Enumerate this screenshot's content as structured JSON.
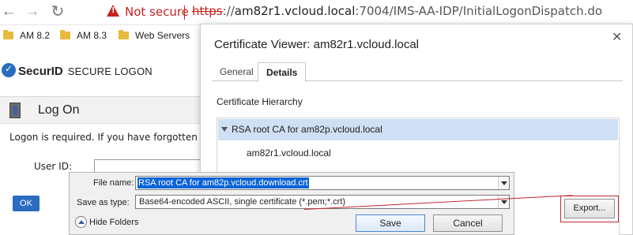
{
  "browser": {
    "security_warning": "Not secure",
    "url": {
      "scheme": "https",
      "separator": "://",
      "host": "am82r1.vcloud.local",
      "rest": ":7004/IMS-AA-IDP/InitialLogonDispatch.do"
    },
    "bookmarks": [
      {
        "label": "AM 8.2"
      },
      {
        "label": "AM 8.3"
      },
      {
        "label": "Web Servers"
      }
    ]
  },
  "page": {
    "brand": "SecurID",
    "brand_sub": "SECURE LOGON",
    "logon_title": "Log On",
    "logon_message": "Logon is required. If you have forgotten y",
    "userid_label": "User ID:",
    "ok_label": "OK"
  },
  "cert_viewer": {
    "title": "Certificate Viewer: am82r1.vcloud.local",
    "tabs": [
      {
        "label": "General"
      },
      {
        "label": "Details"
      }
    ],
    "hierarchy_label": "Certificate Hierarchy",
    "hierarchy": [
      {
        "label": "RSA root CA for am82p.vcloud.local"
      },
      {
        "label": "am82r1.vcloud.local"
      }
    ],
    "export_label": "Export..."
  },
  "save_dialog": {
    "filename_label": "File name:",
    "filename_value": "RSA root CA for am82p.vcloud.download.crt",
    "type_label": "Save as type:",
    "type_value": "Base64-encoded ASCII, single certificate (*.pem;*.crt)",
    "hide_folders_label": "Hide Folders",
    "save_label": "Save",
    "cancel_label": "Cancel"
  },
  "colors": {
    "warning_red": "#c5221f",
    "selection_blue": "#0a64d6",
    "row_highlight": "#cfe0f4",
    "brand_blue": "#2a6cbf"
  }
}
